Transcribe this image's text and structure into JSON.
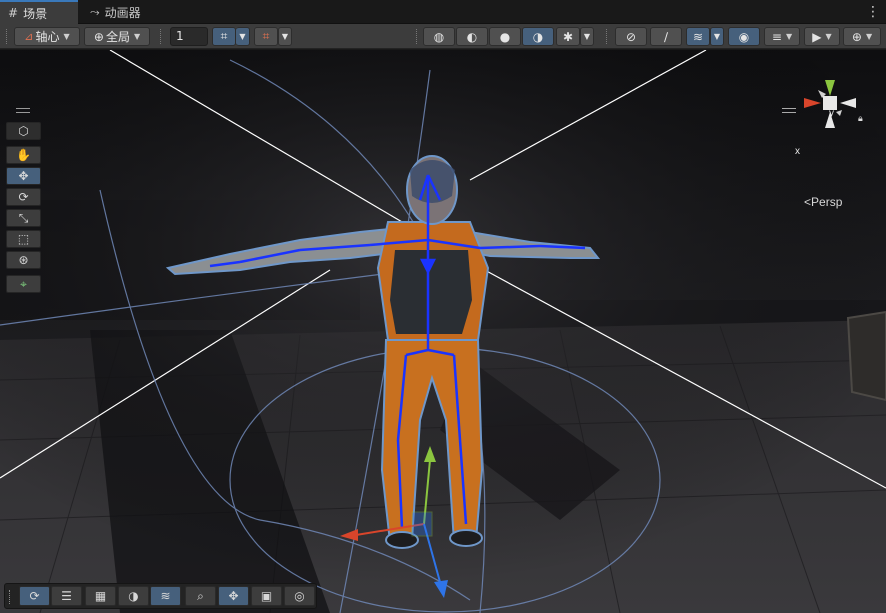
{
  "tabs": [
    {
      "label": "场景",
      "icon": "grid-icon"
    },
    {
      "label": "动画器",
      "icon": "animator-icon"
    }
  ],
  "toolbar": {
    "pivot_label": "轴心",
    "global_label": "全局",
    "grid_value": "1"
  },
  "gizmo": {
    "projection_label": "Persp",
    "y_axis": "y",
    "x_axis": "x"
  },
  "colors": {
    "accent": "#3a79bb",
    "toggle_on": "#46607c",
    "bone": "#1a33ff",
    "x_axis": "#d9452b",
    "y_axis": "#8bc53f",
    "z_axis": "#2e74e8"
  }
}
